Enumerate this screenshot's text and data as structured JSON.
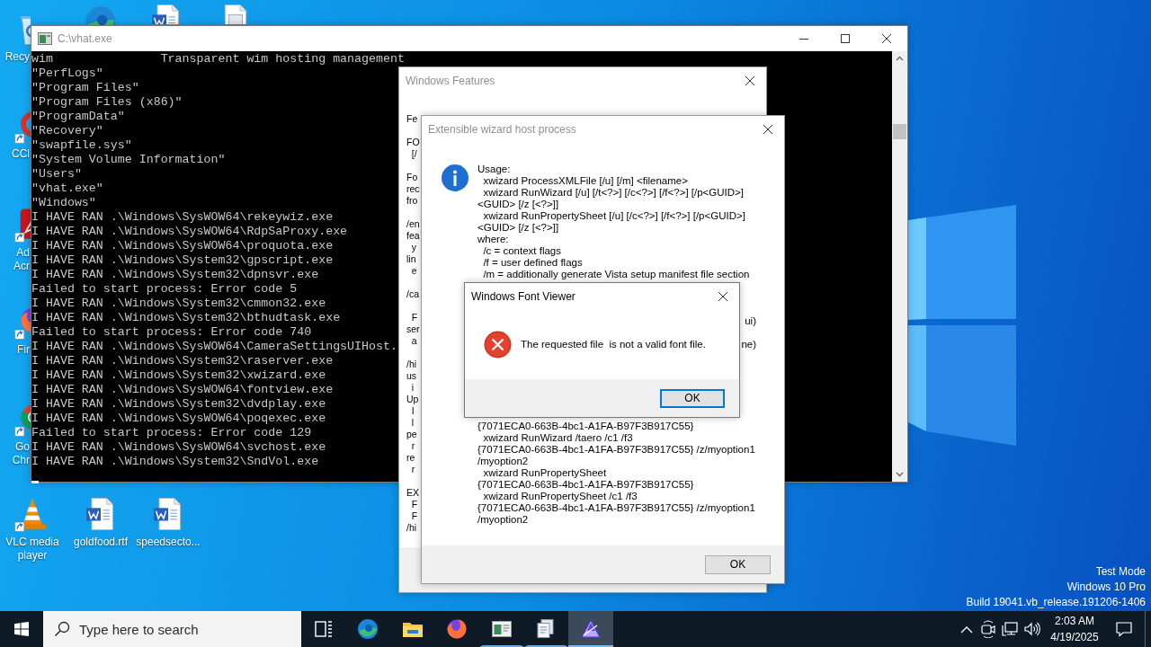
{
  "desktop": {
    "icons": [
      {
        "kind": "recycle-bin",
        "label_lines": [
          "Recy"
        ]
      },
      {
        "kind": "edge"
      },
      {
        "kind": "word-document"
      },
      {
        "kind": "document"
      },
      {
        "kind": "ccleaner",
        "label_lines": [
          "CCl"
        ]
      },
      {
        "kind": "acrobat",
        "label_lines": [
          "Ad",
          "Acr"
        ]
      },
      {
        "kind": "firefox",
        "label_lines": [
          "Fir"
        ]
      },
      {
        "kind": "chrome",
        "label_lines": [
          "Go",
          "Chr"
        ]
      },
      {
        "kind": "vlc",
        "label_lines": [
          "VLC media",
          "player"
        ]
      },
      {
        "kind": "word-document",
        "label_lines": [
          "goldfood.rtf"
        ]
      },
      {
        "kind": "word-document",
        "label_lines": [
          "speedsecto..."
        ]
      }
    ],
    "system_text": [
      "Test Mode",
      "Windows 10 Pro",
      "Build 19041.vb_release.191206-1406"
    ]
  },
  "console": {
    "title": "C:\\vhat.exe",
    "active": false,
    "lines": [
      "wim               Transparent wim hosting management",
      "\"PerfLogs\"",
      "\"Program Files\"",
      "\"Program Files (x86)\"",
      "\"ProgramData\"",
      "\"Recovery\"",
      "\"swapfile.sys\"",
      "\"System Volume Information\"",
      "\"Users\"",
      "\"vhat.exe\"",
      "\"Windows\"",
      "I HAVE RAN .\\Windows\\SysWOW64\\rekeywiz.exe",
      "I HAVE RAN .\\Windows\\SysWOW64\\RdpSaProxy.exe",
      "I HAVE RAN .\\Windows\\SysWOW64\\proquota.exe",
      "I HAVE RAN .\\Windows\\System32\\gpscript.exe",
      "I HAVE RAN .\\Windows\\System32\\dpnsvr.exe",
      "Failed to start process: Error code 5",
      "I HAVE RAN .\\Windows\\System32\\cmmon32.exe",
      "I HAVE RAN .\\Windows\\System32\\bthudtask.exe",
      "Failed to start process: Error code 740",
      "I HAVE RAN .\\Windows\\SysWOW64\\CameraSettingsUIHost.",
      "I HAVE RAN .\\Windows\\System32\\raserver.exe",
      "I HAVE RAN .\\Windows\\System32\\xwizard.exe",
      "I HAVE RAN .\\Windows\\SysWOW64\\fontview.exe",
      "I HAVE RAN .\\Windows\\System32\\dvdplay.exe",
      "I HAVE RAN .\\Windows\\SysWOW64\\poqexec.exe",
      "Failed to start process: Error code 129",
      "I HAVE RAN .\\Windows\\SysWOW64\\svchost.exe",
      "I HAVE RAN .\\Windows\\System32\\SndVol.exe"
    ]
  },
  "features_window": {
    "title": "Windows Features",
    "active": false,
    "paragraphs": [
      [
        "Fe"
      ],
      [
        "FO",
        "  [/"
      ],
      [
        "Fo",
        "rec",
        "fro"
      ],
      [
        "/en",
        "fea",
        "  y",
        "lin",
        "  e"
      ],
      [
        "/ca"
      ],
      [
        "  F",
        "ser",
        "  a"
      ],
      [
        "/hi",
        "us",
        "  i",
        "Up",
        "  I",
        "  l",
        "pe",
        "  r",
        "re",
        "  r"
      ],
      [
        "EX",
        "  F",
        "  F",
        "/hi"
      ]
    ]
  },
  "wizard_dialog": {
    "title": "Extensible wizard host process",
    "active": false,
    "usage_lines": [
      "Usage:",
      "  xwizard ProcessXMLFile [/u] [/m] <filename>",
      "  xwizard RunWizard [/u] [/t<?>] [/c<?>] [/f<?>] [/p<GUID>]",
      "<GUID> [/z [<?>]]",
      "  xwizard RunPropertySheet [/u] [/c<?>] [/f<?>] [/p<GUID>]",
      "<GUID> [/z [<?>]]",
      "where:",
      "  /c = context flags",
      "  /f = user defined flags",
      "  /m = additionally generate Vista setup manifest file section"
    ],
    "covered_line_ends": [
      "ui)",
      "ne)"
    ],
    "example_lines": [
      "{7071ECA0-663B-4bc1-A1FA-B97F3B917C55}",
      "  xwizard RunWizard /taero /c1 /f3",
      "{7071ECA0-663B-4bc1-A1FA-B97F3B917C55} /z/myoption1",
      "/myoption2",
      "  xwizard RunPropertySheet",
      "{7071ECA0-663B-4bc1-A1FA-B97F3B917C55}",
      "  xwizard RunPropertySheet /c1 /f3",
      "{7071ECA0-663B-4bc1-A1FA-B97F3B917C55} /z/myoption1",
      "/myoption2"
    ],
    "button": {
      "label": "OK",
      "focused": false
    }
  },
  "font_viewer_dialog": {
    "title": "Windows Font Viewer",
    "active": true,
    "message": "The requested file  is not a valid font file.",
    "button": {
      "label": "OK",
      "focused": true
    }
  },
  "taskbar": {
    "search": {
      "placeholder": "Type here to search"
    },
    "apps": [
      {
        "kind": "task-view",
        "running": false,
        "selected": false
      },
      {
        "kind": "edge",
        "running": false,
        "selected": false
      },
      {
        "kind": "file-explorer",
        "running": false,
        "selected": false
      },
      {
        "kind": "firefox",
        "running": false,
        "selected": false
      },
      {
        "kind": "window-app",
        "running": true,
        "selected": false
      },
      {
        "kind": "stack-app",
        "running": true,
        "selected": false
      },
      {
        "kind": "wizard-app",
        "running": true,
        "selected": true
      }
    ],
    "clock": {
      "time": "2:03 AM",
      "date": "4/19/2025"
    }
  }
}
